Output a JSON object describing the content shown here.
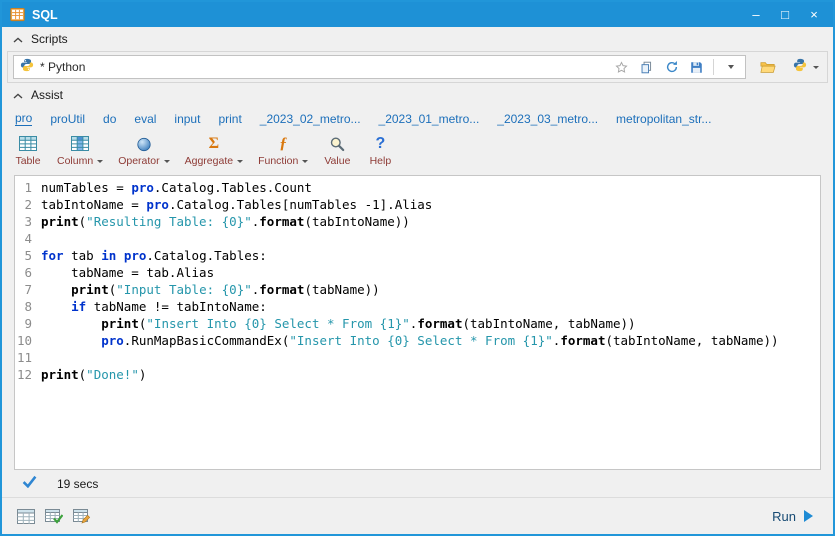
{
  "colors": {
    "titlebar": "#1e91d6",
    "window_border": "#2196d9",
    "keyword_blue": "#0033cc",
    "string_teal": "#2596ab",
    "tab_text": "#1c6fba",
    "tool_label": "#8e3b36",
    "run_blue": "#1e8bd4"
  },
  "window": {
    "title": "SQL",
    "controls": {
      "minimize": "–",
      "maximize": "□",
      "close": "×"
    }
  },
  "scripts": {
    "header": "Scripts",
    "combo_value": "* Python",
    "combo_icons": [
      "python-icon",
      "favorite-star-icon",
      "copy-script-icon",
      "refresh-script-icon",
      "save-script-icon",
      "combo-dropdown-icon"
    ],
    "toolbar_icons": [
      "open-folder-icon",
      "python-script-icon",
      "python-dropdown-icon"
    ]
  },
  "assist": {
    "header": "Assist",
    "tabs": [
      {
        "label": "pro",
        "active": true
      },
      {
        "label": "proUtil",
        "active": false
      },
      {
        "label": "do",
        "active": false
      },
      {
        "label": "eval",
        "active": false
      },
      {
        "label": "input",
        "active": false
      },
      {
        "label": "print",
        "active": false
      },
      {
        "label": "_2023_02_metro...",
        "active": false
      },
      {
        "label": "_2023_01_metro...",
        "active": false
      },
      {
        "label": "_2023_03_metro...",
        "active": false
      },
      {
        "label": "metropolitan_str...",
        "active": false
      }
    ],
    "tools": [
      {
        "label": "Table",
        "icon": "table",
        "dropdown": false
      },
      {
        "label": "Column",
        "icon": "column",
        "dropdown": true
      },
      {
        "label": "Operator",
        "icon": "operator",
        "dropdown": true
      },
      {
        "label": "Aggregate",
        "icon": "aggregate",
        "dropdown": true
      },
      {
        "label": "Function",
        "icon": "function",
        "dropdown": true
      },
      {
        "label": "Value",
        "icon": "value",
        "dropdown": false
      },
      {
        "label": "Help",
        "icon": "help",
        "dropdown": false
      }
    ]
  },
  "editor": {
    "lines": [
      [
        [
          "p",
          "numTables = "
        ],
        [
          "o",
          "pro"
        ],
        [
          "p",
          ".Catalog.Tables.Count"
        ]
      ],
      [
        [
          "p",
          "tabIntoName = "
        ],
        [
          "o",
          "pro"
        ],
        [
          "p",
          ".Catalog.Tables[numTables -1].Alias"
        ]
      ],
      [
        [
          "b",
          "print"
        ],
        [
          "p",
          "("
        ],
        [
          "s",
          "\"Resulting Table: {0}\""
        ],
        [
          "p",
          "."
        ],
        [
          "b",
          "format"
        ],
        [
          "p",
          "(tabIntoName))"
        ]
      ],
      [],
      [
        [
          "k",
          "for"
        ],
        [
          "p",
          " tab "
        ],
        [
          "k",
          "in"
        ],
        [
          "p",
          " "
        ],
        [
          "o",
          "pro"
        ],
        [
          "p",
          ".Catalog.Tables:"
        ]
      ],
      [
        [
          "p",
          "    tabName = tab.Alias"
        ]
      ],
      [
        [
          "p",
          "    "
        ],
        [
          "b",
          "print"
        ],
        [
          "p",
          "("
        ],
        [
          "s",
          "\"Input Table: {0}\""
        ],
        [
          "p",
          "."
        ],
        [
          "b",
          "format"
        ],
        [
          "p",
          "(tabName))"
        ]
      ],
      [
        [
          "p",
          "    "
        ],
        [
          "k",
          "if"
        ],
        [
          "p",
          " tabName != tabIntoName:"
        ]
      ],
      [
        [
          "p",
          "        "
        ],
        [
          "b",
          "print"
        ],
        [
          "p",
          "("
        ],
        [
          "s",
          "\"Insert Into {0} Select * From {1}\""
        ],
        [
          "p",
          "."
        ],
        [
          "b",
          "format"
        ],
        [
          "p",
          "(tabIntoName, tabName))"
        ]
      ],
      [
        [
          "p",
          "        "
        ],
        [
          "o",
          "pro"
        ],
        [
          "p",
          ".RunMapBasicCommandEx("
        ],
        [
          "s",
          "\"Insert Into {0} Select * From {1}\""
        ],
        [
          "p",
          "."
        ],
        [
          "b",
          "format"
        ],
        [
          "p",
          "(tabIntoName, tabName))"
        ]
      ],
      [],
      [
        [
          "b",
          "print"
        ],
        [
          "p",
          "("
        ],
        [
          "s",
          "\"Done!\""
        ],
        [
          "p",
          ")"
        ]
      ]
    ]
  },
  "status": {
    "icon": "success-check-icon",
    "text": "19 secs"
  },
  "footer": {
    "icons": [
      "results-table-icon",
      "verify-table-icon",
      "edit-sql-icon"
    ],
    "run_label": "Run"
  }
}
